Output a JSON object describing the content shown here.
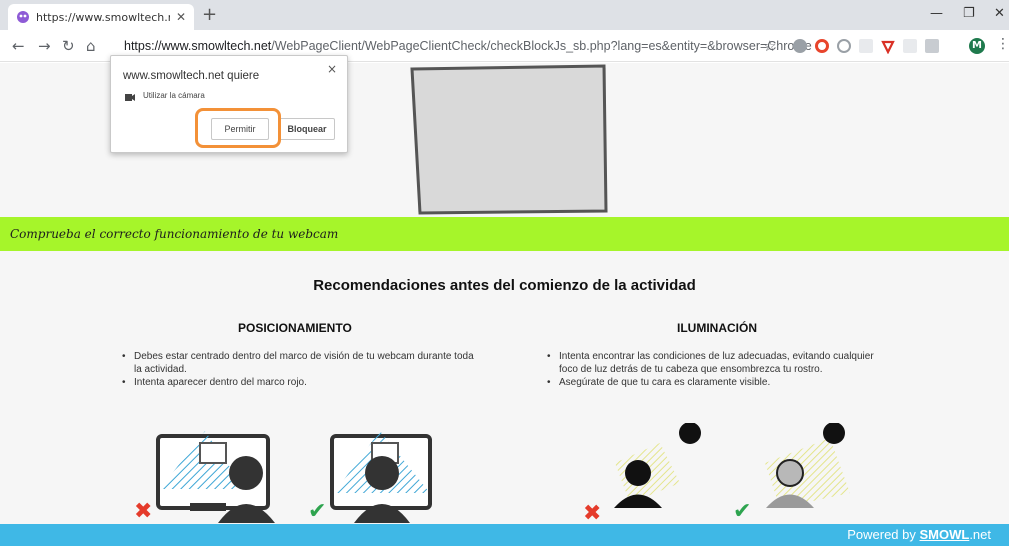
{
  "browser": {
    "tab_title": "https://www.smowltech.net/Web",
    "new_tab": "+",
    "url_host": "https://www.smowltech.net",
    "url_path": "/WebPageClient/WebPageClientCheck/checkBlockJs_sb.php?lang=es&entity=&browser=Chrome",
    "profile_initial": "M"
  },
  "permission_popup": {
    "title": "www.smowltech.net quiere",
    "permission": "Utilizar la cámara",
    "allow_label": "Permitir",
    "block_label": "Bloquear",
    "close": "×"
  },
  "page": {
    "banner_text": "Comprueba el correcto funcionamiento de tu webcam",
    "recommendations_title": "Recomendaciones antes del comienzo de la actividad",
    "positioning": {
      "title": "POSICIONAMIENTO",
      "items": [
        "Debes estar centrado dentro del marco de visión de tu webcam durante toda la actividad.",
        "Intenta aparecer dentro del marco rojo."
      ]
    },
    "lighting": {
      "title": "ILUMINACIÓN",
      "items": [
        "Intenta encontrar las condiciones de luz adecuadas, evitando cualquier foco de luz detrás de tu cabeza que ensombrezca tu rostro.",
        "Asegúrate de que tu cara es claramente visible."
      ]
    },
    "footer_prefix": "Powered by ",
    "footer_brand": "SMOWL",
    "footer_suffix": ".net"
  },
  "colors": {
    "banner": "#a6f52a",
    "footer": "#3fb8e6",
    "highlight": "#f39138",
    "wrong": "#e53b2b",
    "right": "#2ea44f"
  }
}
